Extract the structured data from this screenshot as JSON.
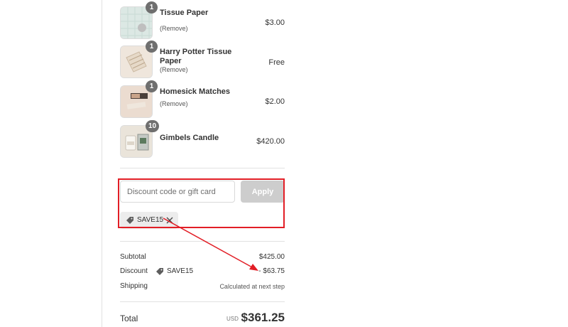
{
  "cart": {
    "items": [
      {
        "name": "Tissue Paper",
        "remove": "(Remove)",
        "price": "$3.00",
        "qty": "1",
        "thumb": "tissue-paper-thumbnail"
      },
      {
        "name": "Harry Potter Tissue Paper",
        "remove": "(Remove)",
        "price": "Free",
        "qty": "1",
        "thumb": "harry-potter-tissue-thumbnail"
      },
      {
        "name": "Homesick Matches",
        "remove": "(Remove)",
        "price": "$2.00",
        "qty": "1",
        "thumb": "matches-thumbnail"
      },
      {
        "name": "Gimbels Candle",
        "remove": "",
        "price": "$420.00",
        "qty": "10",
        "thumb": "candle-thumbnail"
      }
    ]
  },
  "discount": {
    "placeholder": "Discount code or gift card",
    "value": "",
    "apply_label": "Apply",
    "applied_code": "SAVE15"
  },
  "summary": {
    "subtotal_label": "Subtotal",
    "subtotal_value": "$425.00",
    "discount_label": "Discount",
    "discount_code": "SAVE15",
    "discount_value": "- $63.75",
    "shipping_label": "Shipping",
    "shipping_value": "Calculated at next step",
    "total_label": "Total",
    "currency": "USD",
    "total_value": "$361.25"
  },
  "annotation": {
    "highlight_color": "#e21e26",
    "arrow_color": "#e21e26"
  },
  "colors": {
    "apply_button_disabled": "#cdcdcd",
    "quantity_badge": "#6f6f6f",
    "divider": "#e1e1e1"
  }
}
